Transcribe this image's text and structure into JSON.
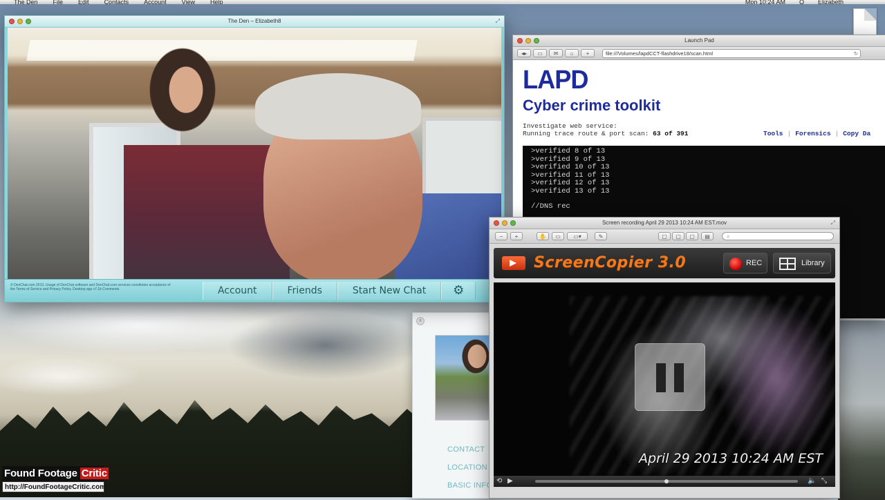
{
  "menubar": {
    "items": [
      "The Den",
      "File",
      "Edit",
      "Contacts",
      "Account",
      "View",
      "Help"
    ],
    "right_items": [
      "Mon 10:24 AM",
      "Q",
      "Elizabeth"
    ]
  },
  "chat_window": {
    "title": "The Den – Elizabeth8",
    "legal_text": "© DenChat.com 2013. Usage of DenChat software and DenChat.com services constitutes acceptance of the Terms of Service and Privacy Policy. Desktop app v7.1b   Comments",
    "nav": {
      "account": "Account",
      "friends": "Friends",
      "start_new_chat": "Start New Chat",
      "settings_icon": "gear-icon"
    }
  },
  "browser_window": {
    "title": "Launch Pad",
    "url": "file:///Volumes/lapdCCT-flashdrive18/scan.html",
    "logo": "LAPD",
    "subtitle": "Cyber crime toolkit",
    "investigate_line1": "Investigate web service:",
    "investigate_line2": "Running trace route & port scan: ",
    "scan_progress": "63 of 391",
    "links": [
      "Tools",
      "Forensics",
      "Copy Da"
    ],
    "console_lines": [
      ">verified 8 of 13",
      ">verified 9 of 13",
      ">verified 10 of 13",
      ">verified 11 of 13",
      ">verified 12 of 13",
      ">verified 13 of 13"
    ],
    "console_footer": "//DNS rec"
  },
  "contact_panel": {
    "close_label": "x",
    "links": [
      "CONTACT",
      "LOCATION",
      "BASIC INFO"
    ]
  },
  "recorder_window": {
    "title": "Screen recording April 29 2013 10:24 AM EST.mov",
    "app_name": "ScreenCopier 3.0",
    "rec_label": "REC",
    "library_label": "Library",
    "timestamp": "April 29 2013 10:24 AM EST",
    "playback_progress": 0.5
  },
  "watermark": {
    "brand_main": "Found Footage ",
    "brand_accent": "Critic",
    "url": "http://FoundFootageCritic.com"
  },
  "colors": {
    "lapd_blue": "#1e2b9a",
    "chat_teal": "#8fd6dc",
    "recorder_orange": "#f07a1d",
    "rec_red": "#d40000"
  }
}
